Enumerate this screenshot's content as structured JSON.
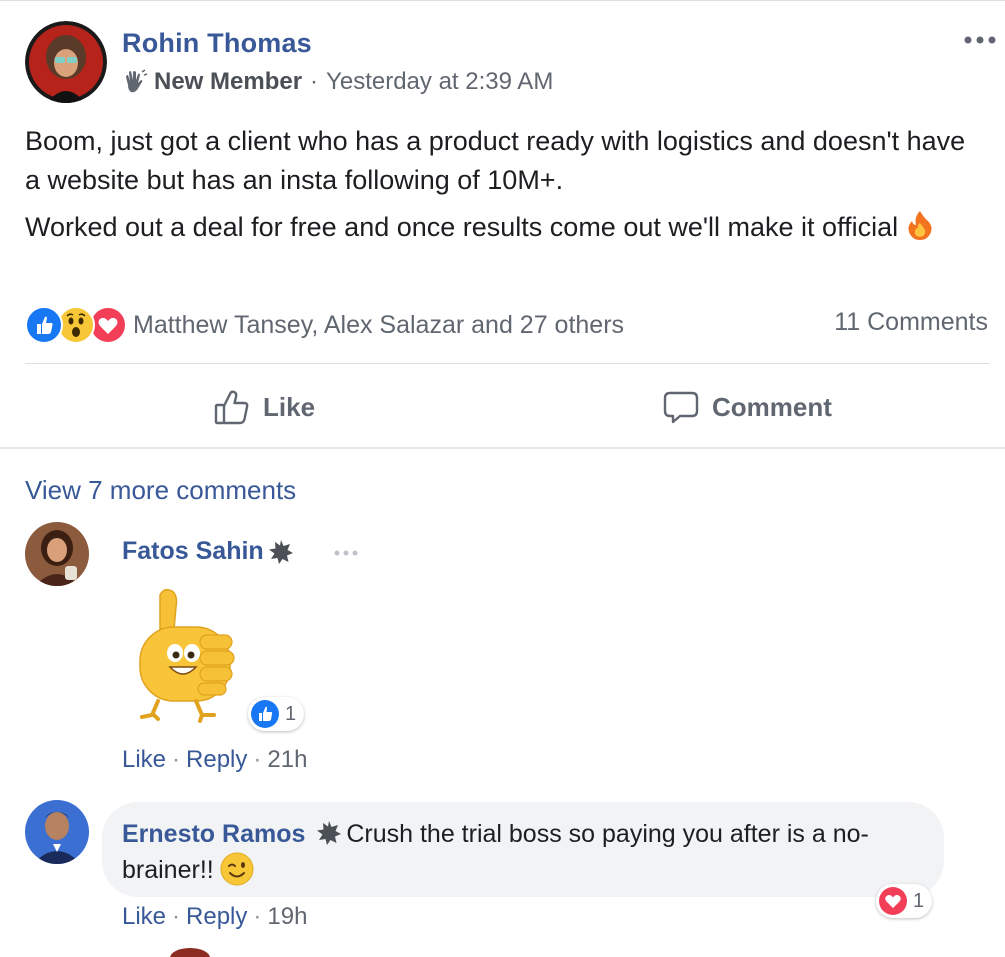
{
  "post": {
    "author": "Rohin Thomas",
    "badge_label": "New Member",
    "separator": "·",
    "timestamp": "Yesterday at 2:39 AM",
    "paragraphs": [
      "Boom, just got a client who has a product ready with logistics and doesn't have a website but has an insta following of 10M+.",
      "Worked out a deal for free and once results come out we'll make it official"
    ],
    "reactions_text": "Matthew Tansey, Alex Salazar and 27 others",
    "comments_count": "11 Comments",
    "like_label": "Like",
    "comment_label": "Comment"
  },
  "comments_section": {
    "view_more": "View 7 more comments",
    "comments": [
      {
        "author": "Fatos Sahin",
        "reaction_count": "1",
        "like_label": "Like",
        "reply_label": "Reply",
        "separator": "·",
        "time": "21h"
      },
      {
        "author": "Ernesto Ramos",
        "text": "Crush the trial boss so paying you after is a no-brainer!!",
        "reaction_count": "1",
        "like_label": "Like",
        "reply_label": "Reply",
        "separator": "·",
        "time": "19h"
      }
    ]
  },
  "colors": {
    "link_blue": "#385898",
    "secondary_text": "#606770",
    "like_blue": "#1877f2",
    "love_red": "#f33e58",
    "bubble_bg": "#f2f3f5"
  },
  "icons": {
    "badge": "waving-hand-icon",
    "more": "more-dots-icon",
    "fire": "fire-emoji",
    "like_reaction": "like-reaction-icon",
    "wow_reaction": "wow-reaction-icon",
    "love_reaction": "love-reaction-icon",
    "like_button": "thumbs-up-outline-icon",
    "comment_button": "speech-bubble-icon",
    "star_badge": "star-badge-icon",
    "sticker": "thumbs-up-sticker",
    "wink": "winking-face-emoji"
  }
}
